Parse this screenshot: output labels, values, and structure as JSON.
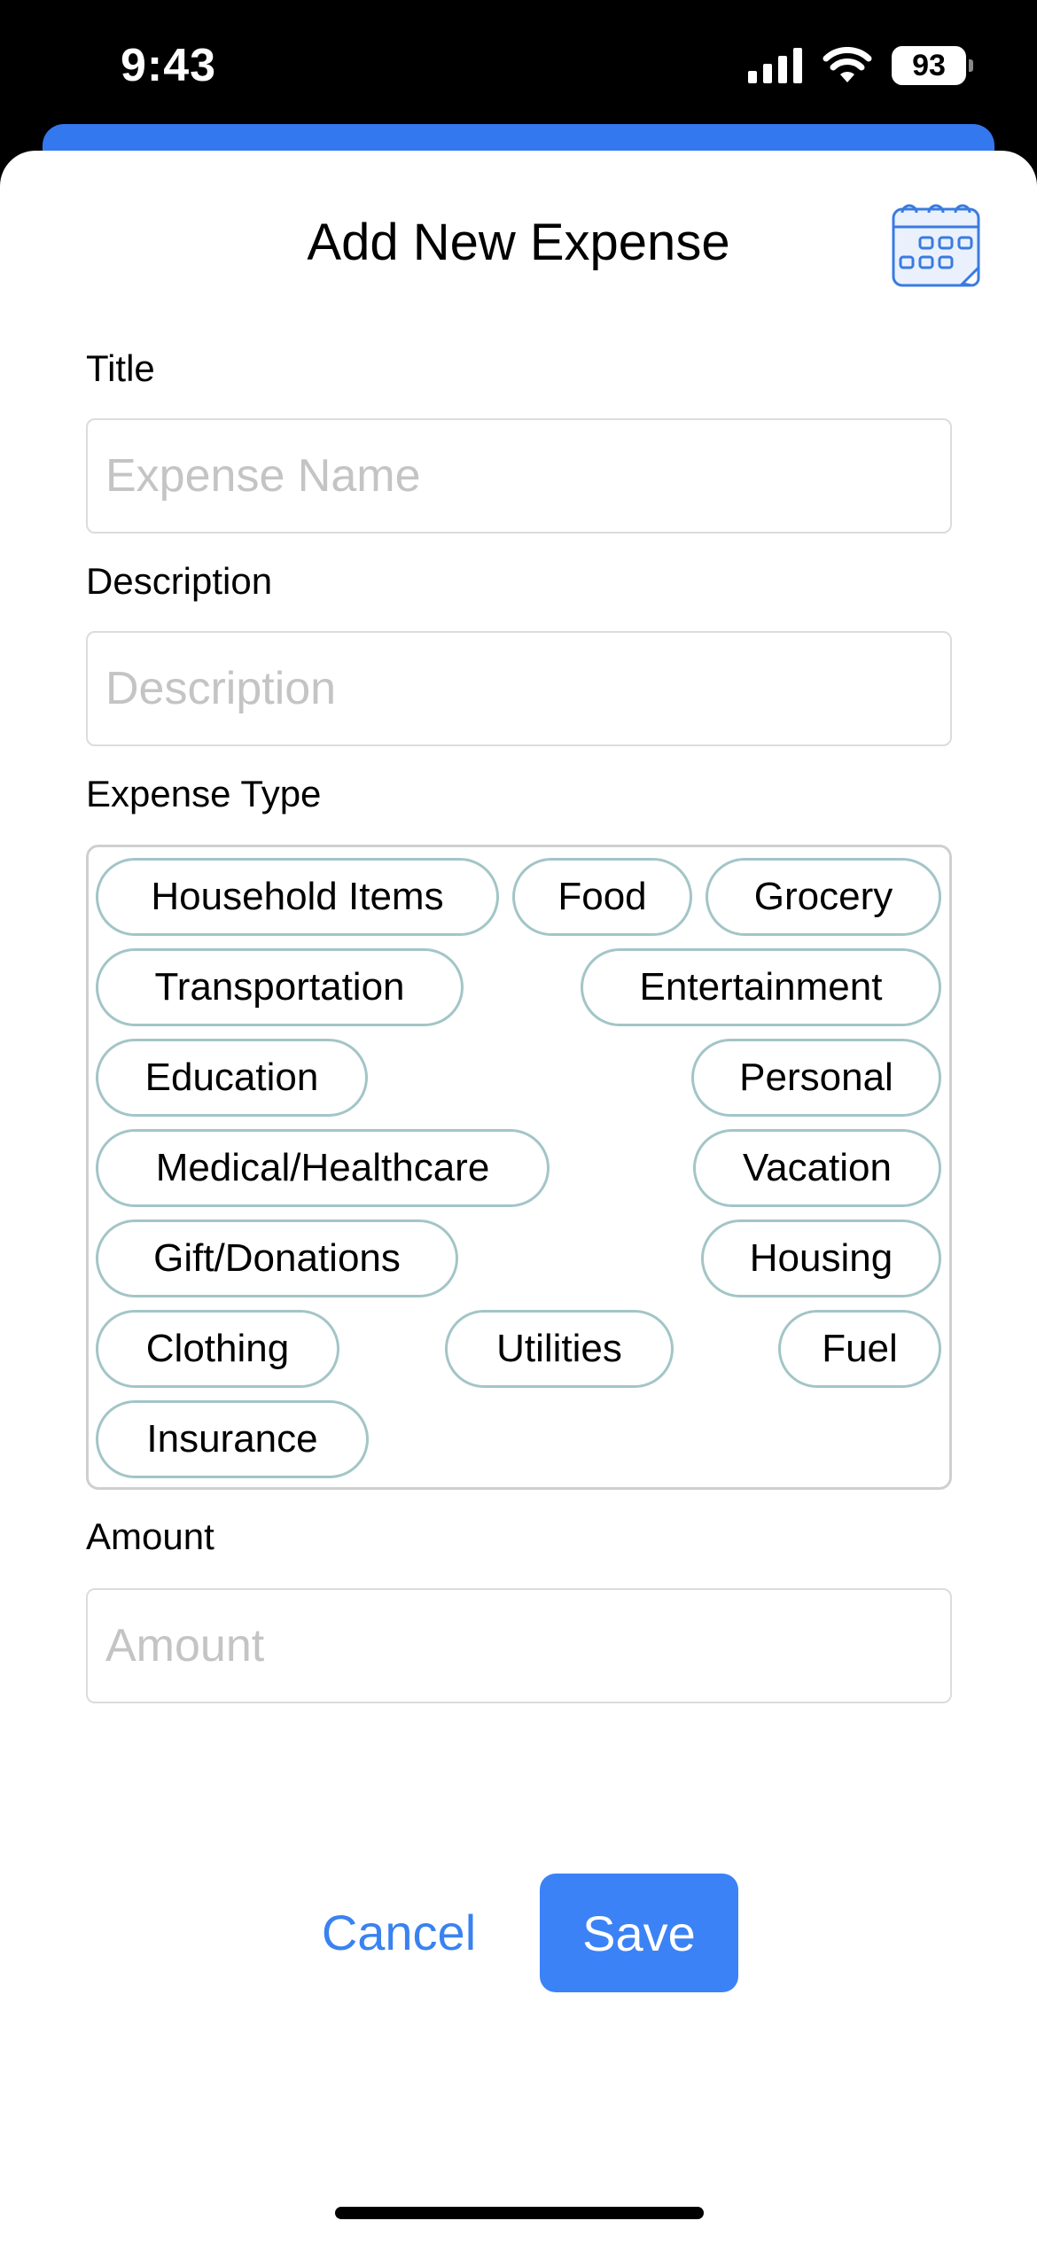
{
  "status_bar": {
    "time": "9:43",
    "battery": "93",
    "icons": [
      "signal-icon",
      "wifi-icon",
      "battery-icon"
    ]
  },
  "sheet": {
    "title": "Add New Expense",
    "calendar_icon": "calendar-icon"
  },
  "form": {
    "title": {
      "label": "Title",
      "placeholder": "Expense Name",
      "value": ""
    },
    "description": {
      "label": "Description",
      "placeholder": "Description",
      "value": ""
    },
    "expense_type": {
      "label": "Expense Type",
      "chips": [
        "Household Items",
        "Food",
        "Grocery",
        "Transportation",
        "Entertainment",
        "Education",
        "Personal",
        "Medical/Healthcare",
        "Vacation",
        "Gift/Donations",
        "Housing",
        "Clothing",
        "Utilities",
        "Fuel",
        "Insurance"
      ]
    },
    "amount": {
      "label": "Amount",
      "placeholder": "Amount",
      "value": ""
    }
  },
  "actions": {
    "cancel_label": "Cancel",
    "save_label": "Save"
  },
  "colors": {
    "accent": "#3b82f6",
    "chip_border": "#a3c5c7",
    "placeholder": "#c4c4c4"
  }
}
